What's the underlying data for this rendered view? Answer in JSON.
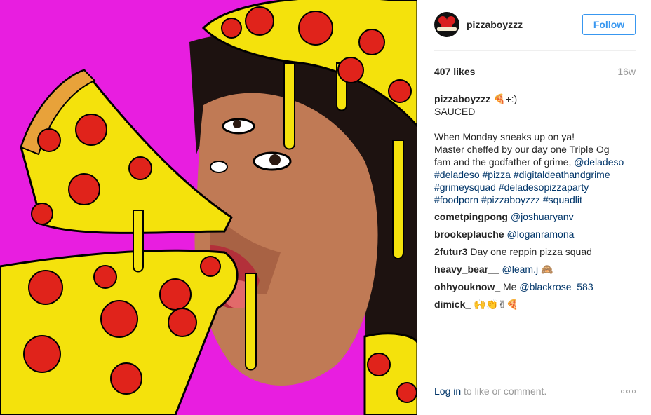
{
  "post": {
    "image_icon": "pizza-art-photo",
    "background_color": "#e81ee0",
    "pizza_color": "#f4e20c",
    "pepperoni_color": "#e0231b"
  },
  "header": {
    "username": "pizzaboyzzz",
    "follow_label": "Follow",
    "accent": "#3897f0"
  },
  "stats": {
    "likes": "407 likes",
    "age": "16w"
  },
  "caption": {
    "author": "pizzaboyzzz",
    "emoji_suffix": "🍕+:)",
    "lines": [
      "SAUCED",
      "",
      "When Monday sneaks up on ya!",
      "Master cheffed by our day one Triple Og"
    ],
    "line5_text": "fam and the godfather of grime, ",
    "mention": "@deladeso",
    "hashtag_lines": [
      "#deladeso #pizza #digitaldeathandgrime",
      "#grimeysquad #deladesopizzaparty",
      "#foodporn #pizzaboyzzz #squadlit"
    ]
  },
  "comments": [
    {
      "user": "cometpingpong",
      "mention": "@joshuaryanv",
      "text": ""
    },
    {
      "user": "brookeplauche",
      "mention": "@loganramona",
      "text": ""
    },
    {
      "user": "2futur3",
      "mention": "",
      "text": "Day one reppin pizza squad"
    },
    {
      "user": "heavy_bear__",
      "mention": "@leam.j",
      "text": "🙈"
    },
    {
      "user": "ohhyouknow_",
      "mention": "@blackrose_583",
      "text": "Me"
    },
    {
      "user": "dimick_",
      "mention": "",
      "text": "🙌👏✌🍕"
    }
  ],
  "footer": {
    "login_label": "Log in",
    "to_like_label": " to like or comment.",
    "more_icon": "more-options-icon"
  },
  "colors": {
    "link": "#003569",
    "muted": "#999999",
    "text": "#262626"
  }
}
